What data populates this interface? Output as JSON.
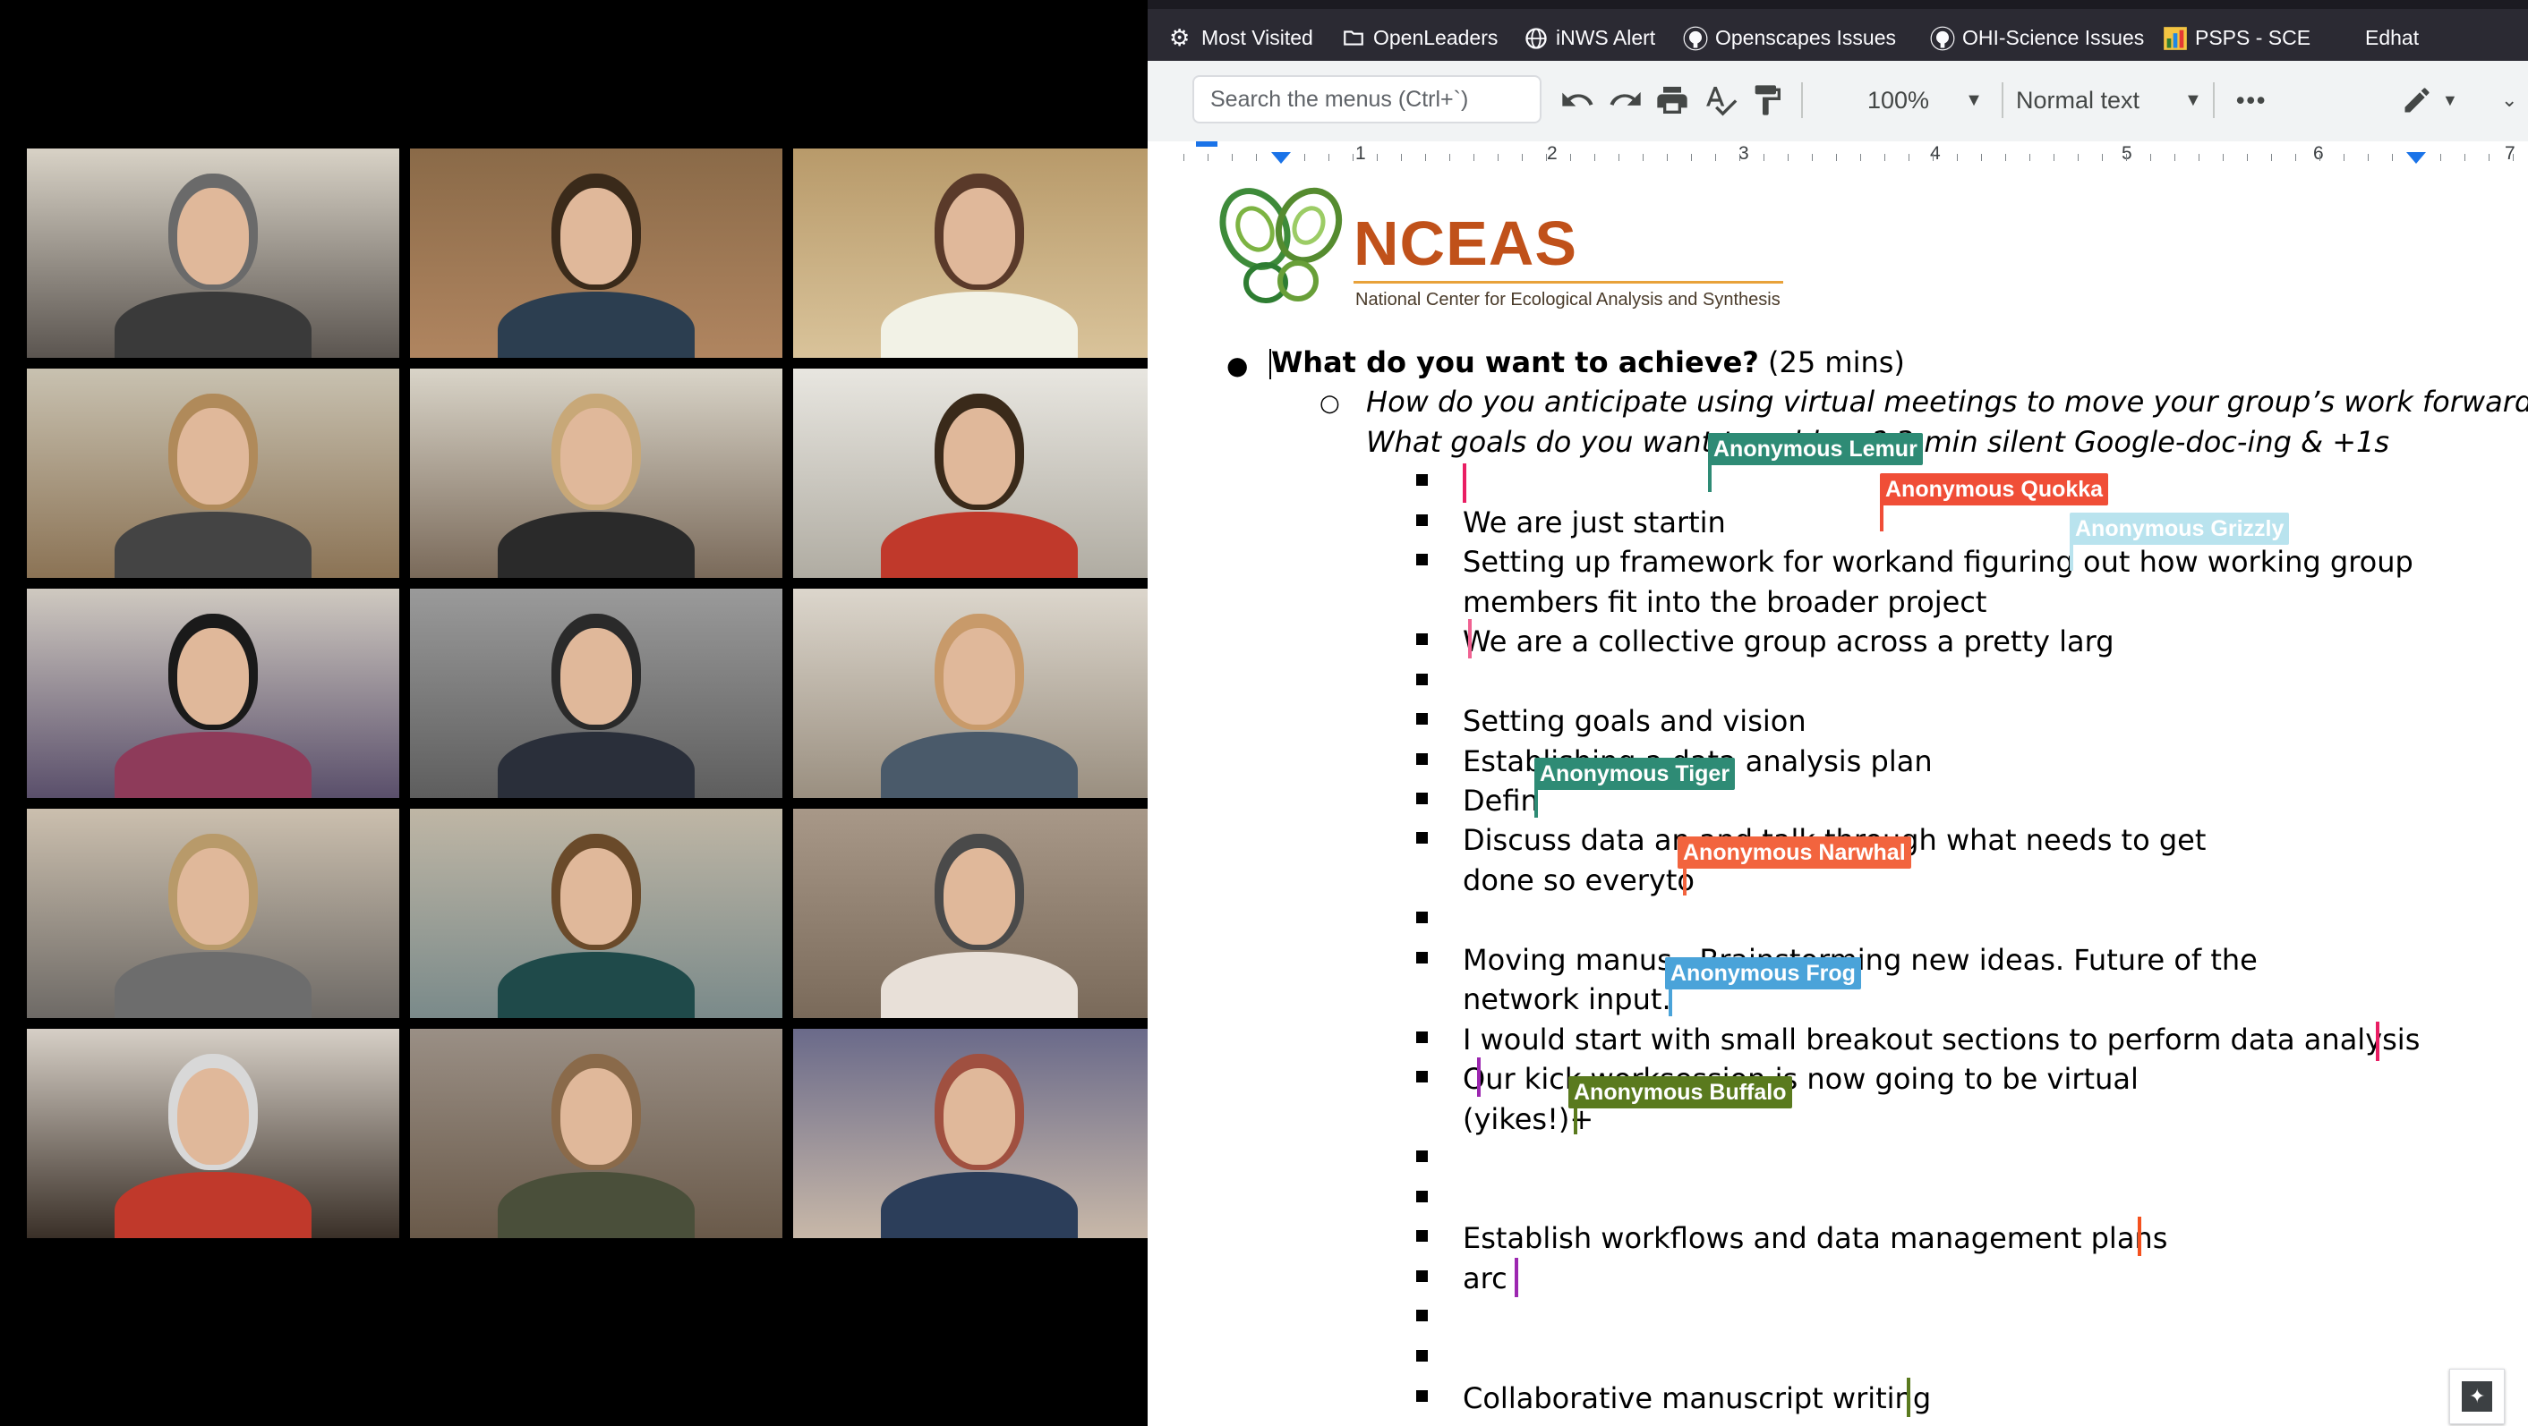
{
  "browser": {
    "bookmarks": [
      {
        "label": "Most Visited",
        "icon": "gear-icon"
      },
      {
        "label": "OpenLeaders",
        "icon": "folder-icon"
      },
      {
        "label": "iNWS Alert",
        "icon": "globe-icon"
      },
      {
        "label": "Openscapes Issues",
        "icon": "github-icon"
      },
      {
        "label": "OHI-Science Issues",
        "icon": "github-icon"
      },
      {
        "label": "PSPS - SCE",
        "icon": "chart-icon"
      },
      {
        "label": "Edhat",
        "icon": ""
      }
    ]
  },
  "toolbar": {
    "search_placeholder": "Search the menus (Ctrl+`)",
    "zoom": "100%",
    "style": "Normal text",
    "more": "•••"
  },
  "ruler": {
    "marks": [
      "1",
      "2",
      "3",
      "4",
      "5",
      "6",
      "7"
    ]
  },
  "logo": {
    "name": "NCEAS",
    "subtitle": "National Center for Ecological Analysis and Synthesis"
  },
  "doc": {
    "heading_bold": "What do you want to achieve?",
    "heading_rest": " (25 mins)",
    "question_1": "How do you anticipate using virtual meetings to move your group’s work forward?",
    "question_2": "What goals do you want to achieve? 3-min silent Google-doc-ing & +1s",
    "items": [
      "",
      "We are just startin",
      "Setting up framework for workand figuring out how working group",
      "members fit into the broader project",
      "We are a collective group across a pretty larg",
      "",
      "Setting goals and vision",
      "Establishing a data analysis plan",
      "Defin",
      "Discuss data an         and talk through what needs to get",
      "done so everyto",
      "",
      "Moving manus                   . Brainstorming new ideas. Future of the",
      "network input.",
      " I would start with small breakout sections to perform data analysis",
      " Our kick          worksession is now going to be virtual",
      "(yikes!)+",
      "",
      "",
      " Establish workflows and data management plans",
      " arc",
      "",
      "",
      " Collaborative manuscript writing"
    ]
  },
  "cursors": [
    {
      "name": "Anonymous Lemur",
      "color": "#2e8b75"
    },
    {
      "name": "Anonymous Quokka",
      "color": "#f04e37"
    },
    {
      "name": "Anonymous Grizzly",
      "color": "#b9e3ee"
    },
    {
      "name": "Anonymous Tiger",
      "color": "#2e8b75"
    },
    {
      "name": "Anonymous Narwhal",
      "color": "#f2643e"
    },
    {
      "name": "Anonymous Frog",
      "color": "#4aa3d9"
    },
    {
      "name": "Anonymous Buffalo",
      "color": "#5a7a1e"
    }
  ]
}
